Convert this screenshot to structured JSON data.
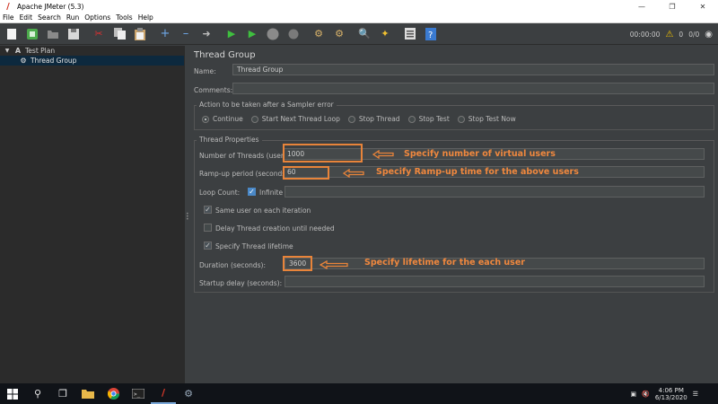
{
  "window": {
    "title": "Apache JMeter (5.3)",
    "minimize_icon": "minimize-icon",
    "restore_icon": "restore-icon",
    "close_icon": "close-icon"
  },
  "menu": [
    "File",
    "Edit",
    "Search",
    "Run",
    "Options",
    "Tools",
    "Help"
  ],
  "toolbar": {
    "timer": "00:00:00",
    "warnings": "0",
    "threads": "0/0"
  },
  "tree": {
    "items": [
      {
        "label": "Test Plan",
        "icon": "test-plan-icon"
      },
      {
        "label": "Thread Group",
        "icon": "gear-icon",
        "selected": true
      }
    ]
  },
  "form": {
    "heading": "Thread Group",
    "name_label": "Name:",
    "name_value": "Thread Group",
    "comments_label": "Comments:",
    "comments_value": "",
    "error_section_title": "Action to be taken after a Sampler error",
    "error_options": [
      {
        "label": "Continue",
        "selected": true
      },
      {
        "label": "Start Next Thread Loop",
        "selected": false
      },
      {
        "label": "Stop Thread",
        "selected": false
      },
      {
        "label": "Stop Test",
        "selected": false
      },
      {
        "label": "Stop Test Now",
        "selected": false
      }
    ],
    "thread_section_title": "Thread Properties",
    "threads_label": "Number of Threads (users):",
    "threads_value": "1000",
    "rampup_label": "Ramp-up period (seconds):",
    "rampup_value": "60",
    "loop_label": "Loop Count:",
    "infinite_label": "Infinite",
    "infinite_checked": true,
    "loop_value": "",
    "same_user_label": "Same user on each iteration",
    "same_user_checked": true,
    "delay_label": "Delay Thread creation until needed",
    "delay_checked": false,
    "lifetime_label": "Specify Thread lifetime",
    "lifetime_checked": true,
    "duration_label": "Duration (seconds):",
    "duration_value": "3600",
    "startup_label": "Startup delay (seconds):",
    "startup_value": ""
  },
  "annotations": {
    "threads_note": "Specify number of virtual users",
    "rampup_note": "Specify Ramp-up time for the above users",
    "duration_note": "Specify lifetime for the each user",
    "color": "#e8843a"
  },
  "taskbar": {
    "time": "4:06 PM",
    "date": "6/13/2020"
  }
}
